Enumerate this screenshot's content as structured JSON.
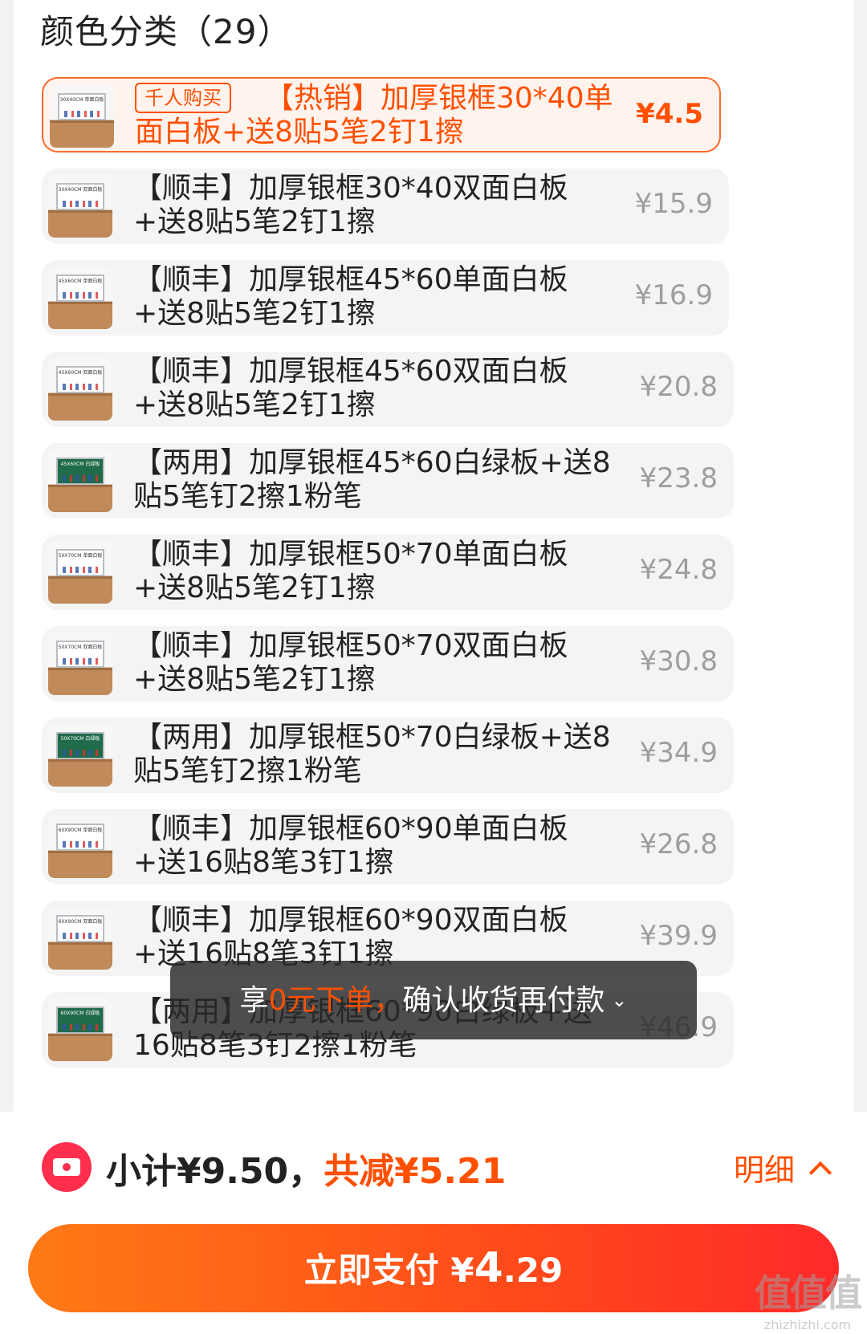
{
  "section": {
    "title": "颜色分类（29）"
  },
  "options": [
    {
      "badge": "千人购买",
      "name": "【热销】加厚银框30*40单面白板+送8贴5笔2钉1擦",
      "price": "¥4.5",
      "selected": true,
      "board": "white",
      "thumb_label": "30X40CM 单面白板"
    },
    {
      "name": "【顺丰】加厚银框30*40双面白板+送8贴5笔2钉1擦",
      "price": "¥15.9",
      "board": "white",
      "thumb_label": "30X40CM 双面白板"
    },
    {
      "name": "【顺丰】加厚银框45*60单面白板+送8贴5笔2钉1擦",
      "price": "¥16.9",
      "board": "white",
      "thumb_label": "45X60CM 单面白板"
    },
    {
      "name": "【顺丰】加厚银框45*60双面白板+送8贴5笔2钉1擦",
      "price": "¥20.8",
      "board": "white",
      "thumb_label": "45X60CM 双面白板"
    },
    {
      "name": "【两用】加厚银框45*60白绿板+送8贴5笔钉2擦1粉笔",
      "price": "¥23.8",
      "board": "green",
      "thumb_label": "45X60CM 白绿板"
    },
    {
      "name": "【顺丰】加厚银框50*70单面白板+送8贴5笔2钉1擦",
      "price": "¥24.8",
      "board": "white",
      "thumb_label": "50X70CM 单面白板"
    },
    {
      "name": "【顺丰】加厚银框50*70双面白板+送8贴5笔2钉1擦",
      "price": "¥30.8",
      "board": "white",
      "thumb_label": "50X70CM 双面白板"
    },
    {
      "name": "【两用】加厚银框50*70白绿板+送8贴5笔钉2擦1粉笔",
      "price": "¥34.9",
      "board": "green",
      "thumb_label": "50X70CM 白绿板"
    },
    {
      "name": "【顺丰】加厚银框60*90单面白板+送16贴8笔3钉1擦",
      "price": "¥26.8",
      "board": "white",
      "thumb_label": "60X90CM 单面白板"
    },
    {
      "name": "【顺丰】加厚银框60*90双面白板+送16贴8笔3钉1擦",
      "price": "¥39.9",
      "board": "white",
      "thumb_label": "60X90CM 双面白板"
    },
    {
      "name": "【两用】加厚银框60*90白绿板+送16贴8笔3钉2擦1粉笔",
      "price": "¥46.9",
      "board": "green",
      "thumb_label": "60X90CM 白绿板"
    }
  ],
  "toast": {
    "prefix": "享",
    "highlight": "0元下单，",
    "suffix": "确认收货再付款"
  },
  "summary": {
    "subtotal": "小计¥9.50，",
    "discount": "共减¥5.21",
    "detail": "明细"
  },
  "pay": {
    "label": "立即支付 ¥",
    "amount_int": "4",
    "amount_dec": ".29"
  },
  "watermark": {
    "logo": "值值值",
    "url": "zhizhizhi.com"
  },
  "icons": {
    "coupon": "coupon-icon",
    "detail": "chevron-up-icon",
    "toast": "chevron-down-double-icon"
  },
  "colors": {
    "accent": "#ff5000",
    "pay_gradient_start": "#ff7a16",
    "pay_gradient_end": "#ff2a2a"
  }
}
